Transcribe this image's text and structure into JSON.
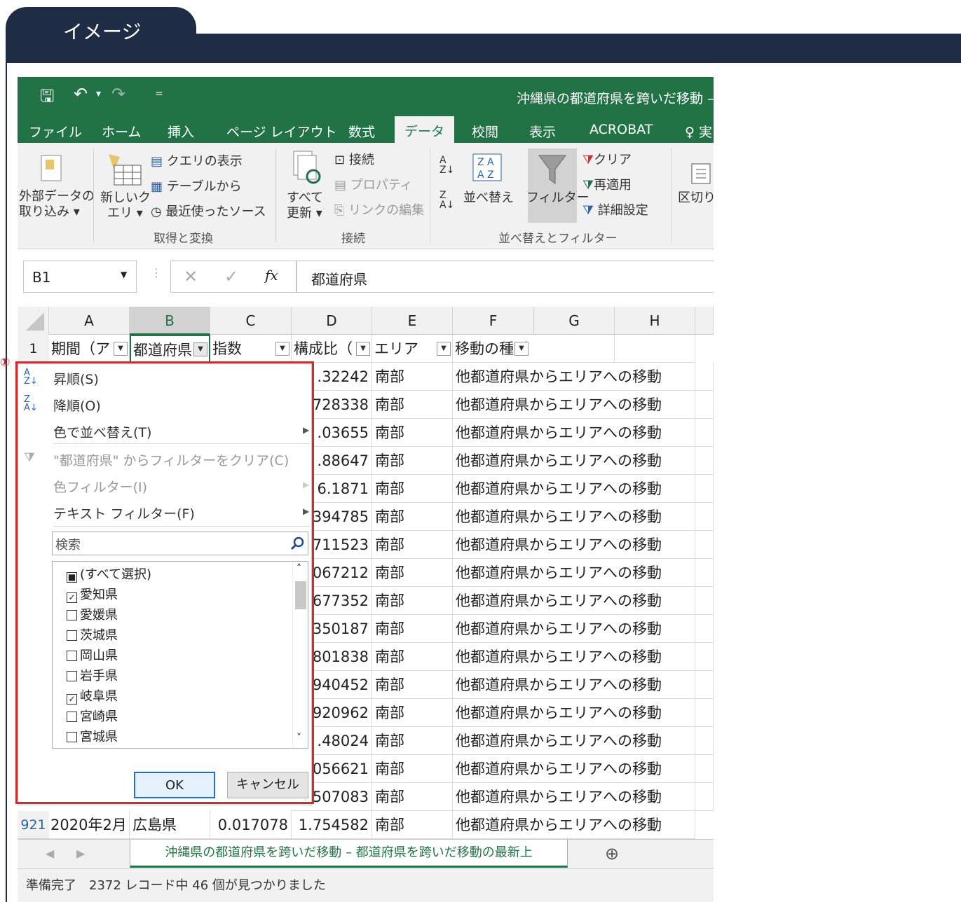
{
  "header": {
    "title": "イメージ"
  },
  "excel": {
    "doc_title": "沖縄県の都道府県を跨いだ移動 – 都",
    "ribbon_tabs": [
      "ファイル",
      "ホーム",
      "挿入",
      "ページ レイアウト",
      "数式",
      "データ",
      "校閲",
      "表示",
      "ACROBAT",
      "♀ 実"
    ],
    "ribbon": {
      "external_data": [
        "外部データの",
        "取り込み ▾"
      ],
      "new_query": [
        "新しいク",
        "エリ ▾"
      ],
      "show_query": "クエリの表示",
      "from_table": "テーブルから",
      "recent_sources": "最近使ったソース",
      "group_get": "取得と変換",
      "refresh_all": [
        "すべて",
        "更新 ▾"
      ],
      "connections": "接続",
      "properties": "プロパティ",
      "edit_links": "リンクの編集",
      "group_conn": "接続",
      "sort": "並べ替え",
      "filter": "フィルター",
      "clear": "クリア",
      "reapply": "再適用",
      "advanced": "詳細設定",
      "group_sort": "並べ替えとフィルター",
      "text_to_columns": "区切り"
    },
    "name_box": "B1",
    "formula": "都道府県",
    "columns": [
      "A",
      "B",
      "C",
      "D",
      "E",
      "F",
      "G",
      "H"
    ],
    "header_row": {
      "row_num": "1",
      "a": "期間（ア",
      "b": "都道府県",
      "c": "指数",
      "d": "構成比（",
      "e": "エリア",
      "f": "移動の種別"
    },
    "visible_rows": [
      {
        "d": ".32242",
        "e": "南部",
        "f": "他都道府県からエリアへの移動"
      },
      {
        "d": "728338",
        "e": "南部",
        "f": "他都道府県からエリアへの移動"
      },
      {
        "d": ".03655",
        "e": "南部",
        "f": "他都道府県からエリアへの移動"
      },
      {
        "d": ".88647",
        "e": "南部",
        "f": "他都道府県からエリアへの移動"
      },
      {
        "d": "6.1871",
        "e": "南部",
        "f": "他都道府県からエリアへの移動"
      },
      {
        "d": "394785",
        "e": "南部",
        "f": "他都道府県からエリアへの移動"
      },
      {
        "d": "711523",
        "e": "南部",
        "f": "他都道府県からエリアへの移動"
      },
      {
        "d": "067212",
        "e": "南部",
        "f": "他都道府県からエリアへの移動"
      },
      {
        "d": "677352",
        "e": "南部",
        "f": "他都道府県からエリアへの移動"
      },
      {
        "d": "350187",
        "e": "南部",
        "f": "他都道府県からエリアへの移動"
      },
      {
        "d": "801838",
        "e": "南部",
        "f": "他都道府県からエリアへの移動"
      },
      {
        "d": "940452",
        "e": "南部",
        "f": "他都道府県からエリアへの移動"
      },
      {
        "d": "920962",
        "e": "南部",
        "f": "他都道府県からエリアへの移動"
      },
      {
        "d": ".48024",
        "e": "南部",
        "f": "他都道府県からエリアへの移動"
      },
      {
        "d": "056621",
        "e": "南部",
        "f": "他都道府県からエリアへの移動"
      },
      {
        "d": "507083",
        "e": "南部",
        "f": "他都道府県からエリアへの移動"
      }
    ],
    "last_row": {
      "row_num": "921",
      "a": "2020年2月",
      "b": "広島県",
      "c": "0.017078",
      "d": "1.754582",
      "e": "南部",
      "f": "他都道府県からエリアへの移動"
    },
    "sheet_tab": "沖縄県の都道府県を跨いだ移動 – 都道府県を跨いだ移動の最新上",
    "status": "準備完了　2372 レコード中 46 個が見つかりました"
  },
  "filter_menu": {
    "badge": "①",
    "sort_asc": "昇順(S)",
    "sort_desc": "降順(O)",
    "sort_color": "色で並べ替え(T)",
    "clear_filter": "\"都道府県\" からフィルターをクリア(C)",
    "color_filter": "色フィルター(I)",
    "text_filter": "テキスト フィルター(F)",
    "search_placeholder": "検索",
    "items": [
      {
        "label": "(すべて選択)",
        "state": "partial"
      },
      {
        "label": "愛知県",
        "state": "checked"
      },
      {
        "label": "愛媛県",
        "state": "unchecked"
      },
      {
        "label": "茨城県",
        "state": "unchecked"
      },
      {
        "label": "岡山県",
        "state": "unchecked"
      },
      {
        "label": "岩手県",
        "state": "unchecked"
      },
      {
        "label": "岐阜県",
        "state": "checked"
      },
      {
        "label": "宮崎県",
        "state": "unchecked"
      },
      {
        "label": "宮城県",
        "state": "unchecked"
      }
    ],
    "ok": "OK",
    "cancel": "キャンセル"
  },
  "colors": {
    "excel_green": "#217346",
    "header_navy": "#1e2d45",
    "highlight_red": "#d12c2c"
  }
}
